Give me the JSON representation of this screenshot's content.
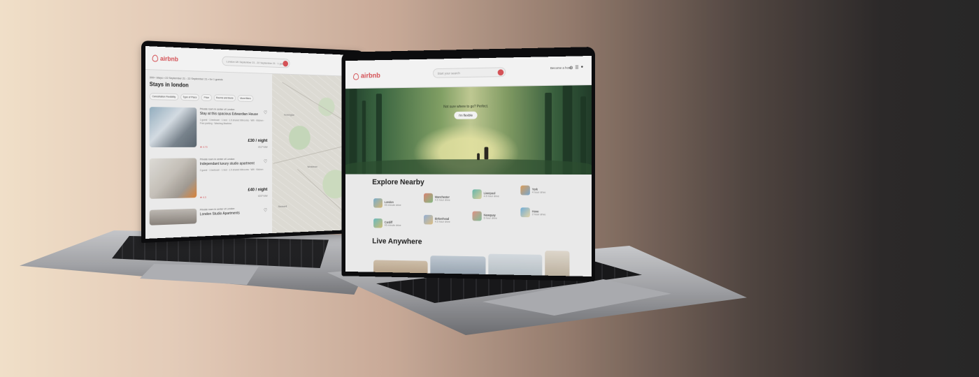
{
  "colors": {
    "brand": "#e0565b"
  },
  "left_laptop": {
    "logo_text": "airbnb",
    "search_text": "London UK September 21 - 22 September 21 · 1 guests",
    "breadcrumb": "300+ Stays • 22 September 21 - 22 September 21 • for 1 guests",
    "title": "Stays in london",
    "filters": [
      "Cancellation Flexibility",
      "Type of Place",
      "Price",
      "Rooms and Beds",
      "More filters"
    ],
    "listings": [
      {
        "subtitle": "Private room in center of London",
        "name": "Stay at this spacious Edwardian House",
        "meta": "1 guest · 1 bedroom · 1 bed · 1.5 shared bthrooms · Wifi · Kitchen · Free parking · Washing Machine",
        "rating": "★ 4.73",
        "price": "£30 / night",
        "total": "£117 total"
      },
      {
        "subtitle": "Private room in center of London",
        "name": "Independant luxury studio apartment",
        "meta": "2 guest · 1 bedroom · 1 bed · 1.5 shared bthrooms · Wifi · Kitchen",
        "rating": "★ 4.3",
        "price": "£40 / night",
        "total": "£157 total"
      },
      {
        "subtitle": "Private room in center of London",
        "name": "London Studio Apartments"
      }
    ],
    "map_labels": [
      "Kennington",
      "Wimbledon",
      "Stockwell"
    ]
  },
  "right_laptop": {
    "logo_text": "airbnb",
    "search_placeholder": "Start your search",
    "host_link": "Become a host",
    "hero_text": "Not sure where to go? Perfect.",
    "hero_button": "I'm flexible",
    "explore_title": "Explore Nearby",
    "nearby": [
      {
        "name": "London",
        "dist": "45 minute drive"
      },
      {
        "name": "Manchester",
        "dist": "4.5 hour drive"
      },
      {
        "name": "Liverpool",
        "dist": "4.5 hour drive"
      },
      {
        "name": "York",
        "dist": "4 hour drive"
      },
      {
        "name": "Cardiff",
        "dist": "45 minute drive"
      },
      {
        "name": "Birkenhead",
        "dist": "4.5 hour drive"
      },
      {
        "name": "Newquay",
        "dist": "6 hour drive"
      },
      {
        "name": "Hove",
        "dist": "2 hour drive"
      }
    ],
    "live_title": "Live Anywhere"
  }
}
